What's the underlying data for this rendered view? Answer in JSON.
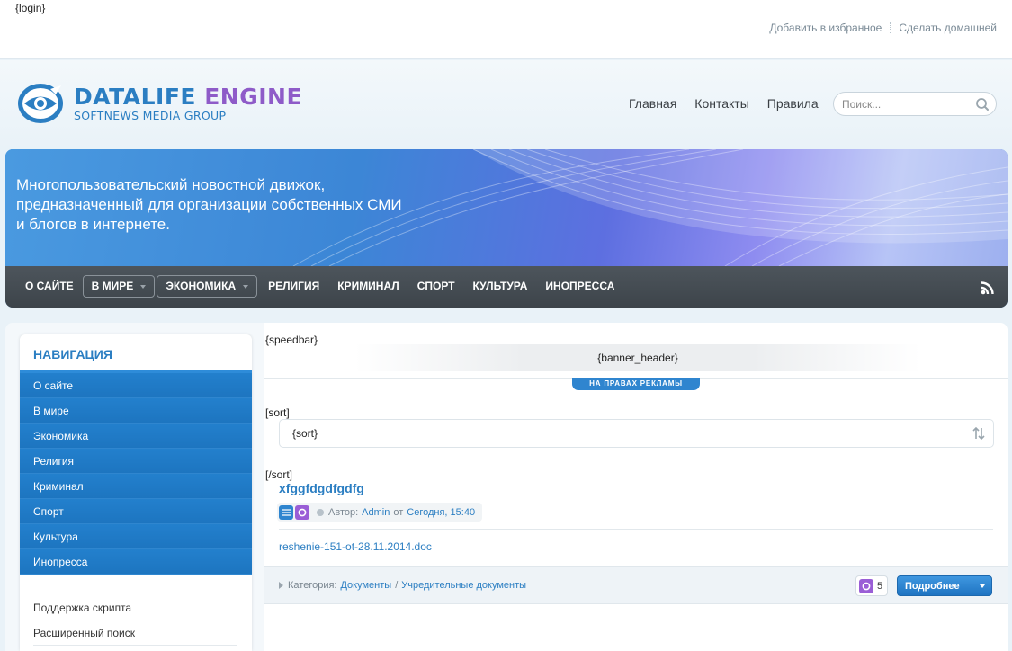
{
  "topbar": {
    "login_tag": "{login}",
    "links": [
      "Добавить в избранное",
      "Сделать домашней"
    ]
  },
  "header": {
    "logo_word1": "DATALIFE",
    "logo_word2": "ENGINE",
    "logo_sub": "SOFTNEWS MEDIA GROUP",
    "nav": [
      "Главная",
      "Контакты",
      "Правила"
    ],
    "search_placeholder": "Поиск..."
  },
  "banner": {
    "text": "Многопользовательский новостной движок, предназначенный для организации собственных СМИ и блогов в интернете."
  },
  "categories": {
    "items": [
      "О сайте",
      "В мире",
      "Экономика",
      "Религия",
      "Криминал",
      "Спорт",
      "Культура",
      "Инопресса"
    ],
    "dropdowns": [
      false,
      true,
      true,
      false,
      false,
      false,
      false,
      false
    ],
    "rss_icon": "rss-icon"
  },
  "sidebar": {
    "title": "НАВИГАЦИЯ",
    "menu": [
      "О сайте",
      "В мире",
      "Экономика",
      "Религия",
      "Криминал",
      "Спорт",
      "Культура",
      "Инопресса"
    ],
    "extra": [
      "Поддержка скрипта",
      "Расширенный поиск"
    ]
  },
  "content": {
    "speedbar_tag": "{speedbar}",
    "banner_header_tag": "{banner_header}",
    "ad_badge": "НА ПРАВАХ РЕКЛАМЫ",
    "sort_open_tag": "[sort]",
    "sort_value": "{sort}",
    "sort_close_tag": "[/sort]",
    "news": {
      "title": "xfggfdgdfgdfg",
      "author_label": "Автор:",
      "author": "Admin",
      "date_prefix": "от",
      "date": "Сегодня, 15:40",
      "file_link": "reshenie-151-ot-28.11.2014.doc",
      "category_label": "Категория:",
      "category_1": "Документы",
      "category_sep": "/",
      "category_2": "Учредительные документы",
      "comments_count": "5",
      "more_label": "Подробнее"
    }
  },
  "colors": {
    "accent_blue": "#2b7ec2",
    "accent_purple": "#8e5bc8",
    "navbar_dark": "#454c52"
  }
}
